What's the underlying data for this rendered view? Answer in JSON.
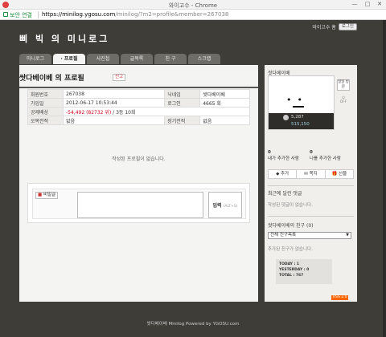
{
  "window": {
    "title": "와이고수 - Chrome",
    "minimize": "—",
    "maximize": "□",
    "close": "✕"
  },
  "address": {
    "secure_label": "보안 연결",
    "url_host": "https://minilog.ygosu.com",
    "url_rest": "/minilog/?m2=profile&member=267038"
  },
  "header": {
    "user_link": "와이고수 홈",
    "logout_label": "로그인",
    "blog_title": "삐 빅 의 미니로그",
    "tabs": [
      "미니로그",
      "· 프로필",
      "사진첩",
      "글목록",
      "친 구",
      "스크랩"
    ]
  },
  "profile": {
    "title": "쌋다베이베 의 프로필",
    "report_label": "신고",
    "rows": [
      {
        "label1": "회원번호",
        "value1": "267038",
        "label2": "닉네임",
        "value2": "쌋다베이베"
      },
      {
        "label1": "가입일",
        "value1": "2012-06-17 10:53:44",
        "label2": "로그인",
        "value2": "4665 회"
      },
      {
        "label1": "공제배상",
        "value1_red": "-54,492 (82732 위)",
        "value1_rest": " / 3등 10회",
        "label2": "",
        "value2": ""
      },
      {
        "label1": "오목전적",
        "value1": "없음",
        "label2": "장기전적",
        "value2": "없음"
      }
    ],
    "empty_message": "작성된 프로필이 없습니다."
  },
  "comment": {
    "secret_label": "비밀글",
    "secret_prefix": "■",
    "submit_label": "입력",
    "submit_hint": "(ALT+S)"
  },
  "sidebar": {
    "name": "쌋다베이베",
    "stats_line1": "5,287",
    "stats_line2": "515,150",
    "level_label": "lv",
    "side_btn1": "일일 방문",
    "off_label": "OFF",
    "friend_count_a": "0",
    "friend_label_a": "내가 추가한 사람",
    "friend_count_b": "0",
    "friend_label_b": "나를 추가한 사람",
    "actions": [
      "◆ 추가",
      "✉ 쪽지",
      "🎁 선물"
    ],
    "recent_comments_heading": "최근에 달린 댓글",
    "recent_comments_empty": "작성된 댓글이 없습니다.",
    "friends_heading": "쌋다베이베의 친구 (0)",
    "friend_select": "전체 친구목록",
    "friends_empty": "추가된 친구가 없습니다.",
    "counter": {
      "today": "TODAY : 1",
      "yesterday": "YESTERDAY : 0",
      "total": "TOTAL : 767"
    },
    "rss_label": "RSS 2.0"
  },
  "footer": {
    "text": "쌋다베이베 Minilog Powered by YGOSU.com"
  }
}
